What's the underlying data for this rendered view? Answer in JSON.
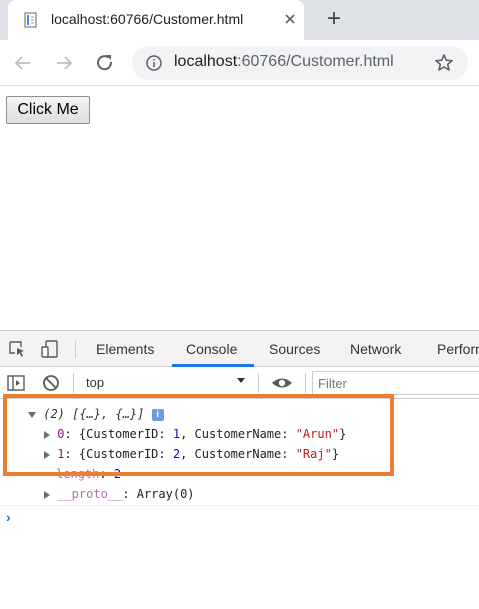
{
  "browser": {
    "tab_title": "localhost:60766/Customer.html",
    "new_tab_symbol": "+",
    "url_host": "localhost",
    "url_rest": ":60766/Customer.html"
  },
  "page": {
    "button_label": "Click Me"
  },
  "devtools": {
    "tabs": [
      "Elements",
      "Console",
      "Sources",
      "Network",
      "Perform"
    ],
    "active_tab": "Console",
    "context": "top",
    "filter_placeholder": "Filter",
    "log": {
      "summary": "(2) [{…}, {…}]",
      "badge": "i",
      "items": [
        {
          "index": "0",
          "id_key": "CustomerID",
          "id_val": "1",
          "name_key": "CustomerName",
          "name_val": "\"Arun\""
        },
        {
          "index": "1",
          "id_key": "CustomerID",
          "id_val": "2",
          "name_key": "CustomerName",
          "name_val": "\"Raj\""
        }
      ],
      "length_key": "length",
      "length_val": "2",
      "proto_key": "__proto__",
      "proto_val": "Array(0)"
    },
    "prompt_symbol": "›"
  },
  "colors": {
    "highlight": "#ed7d31",
    "active_tab_underline": "#1a73e8",
    "string_value": "#c41a16",
    "number_value": "#1c00cf",
    "key_purple": "#881391"
  }
}
